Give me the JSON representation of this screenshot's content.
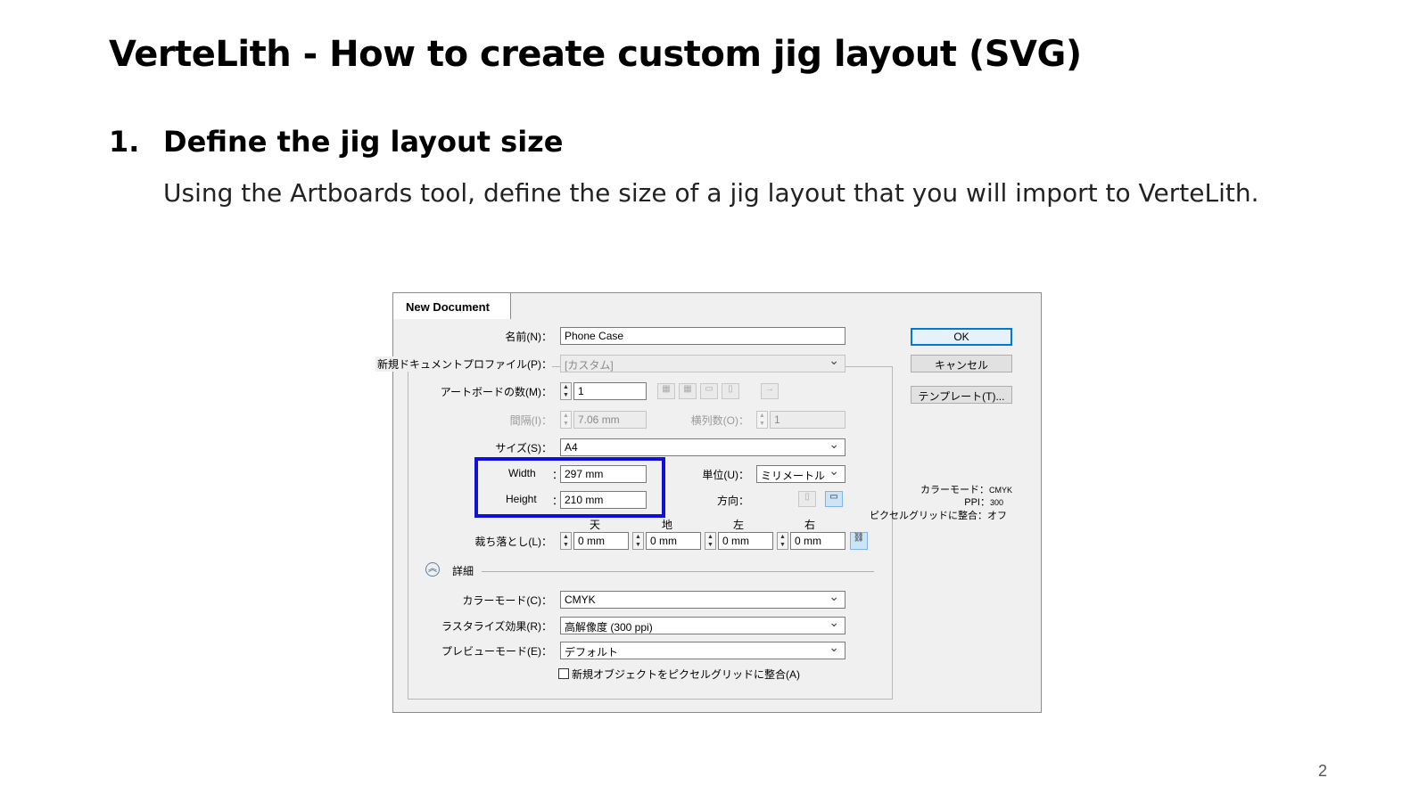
{
  "slide": {
    "title": "VerteLith - How to create custom jig layout (SVG)",
    "step_number": "1.",
    "step_title": "Define the jig layout size",
    "step_body": "Using the Artboards tool, define the size of a jig layout that you will import to VerteLith.",
    "page_number": "2"
  },
  "dialog": {
    "tab_title": "New Document",
    "name_label": "名前(N)：",
    "name_value": "Phone Case",
    "profile_label": "新規ドキュメントプロファイル(P)：",
    "profile_value": "[カスタム]",
    "artboards_label": "アートボードの数(M)：",
    "artboards_value": "1",
    "spacing_label": "間隔(I)：",
    "spacing_value": "7.06 mm",
    "columns_label": "横列数(O)：",
    "columns_value": "1",
    "size_label": "サイズ(S)：",
    "size_value": "A4",
    "width_label": "Width",
    "width_value": "297 mm",
    "height_label": "Height",
    "height_value": "210 mm",
    "colon": "：",
    "units_label": "単位(U)：",
    "units_value": "ミリメートル",
    "orientation_label": "方向：",
    "bleed_top_label": "天",
    "bleed_bottom_label": "地",
    "bleed_left_label": "左",
    "bleed_right_label": "右",
    "bleed_label": "裁ち落とし(L)：",
    "bleed_top": "0 mm",
    "bleed_bottom": "0 mm",
    "bleed_left": "0 mm",
    "bleed_right": "0 mm",
    "advanced_label": "詳細",
    "color_mode_label": "カラーモード(C)：",
    "color_mode_value": "CMYK",
    "raster_label": "ラスタライズ効果(R)：",
    "raster_value": "高解像度 (300 ppi)",
    "preview_label": "プレビューモード(E)：",
    "preview_value": "デフォルト",
    "align_pixel_label": "新規オブジェクトをピクセルグリッドに整合(A)",
    "ok_label": "OK",
    "cancel_label": "キャンセル",
    "templates_label": "テンプレート(T)...",
    "info_color_mode_label": "カラーモード：",
    "info_color_mode_value": "CMYK",
    "info_ppi_label": "PPI：",
    "info_ppi_value": "300",
    "info_pixel_label": "ピクセルグリッドに整合：",
    "info_pixel_value": "オフ"
  },
  "colors": {
    "highlight_box": "#1010d8",
    "default_button_border": "#0078d7"
  }
}
